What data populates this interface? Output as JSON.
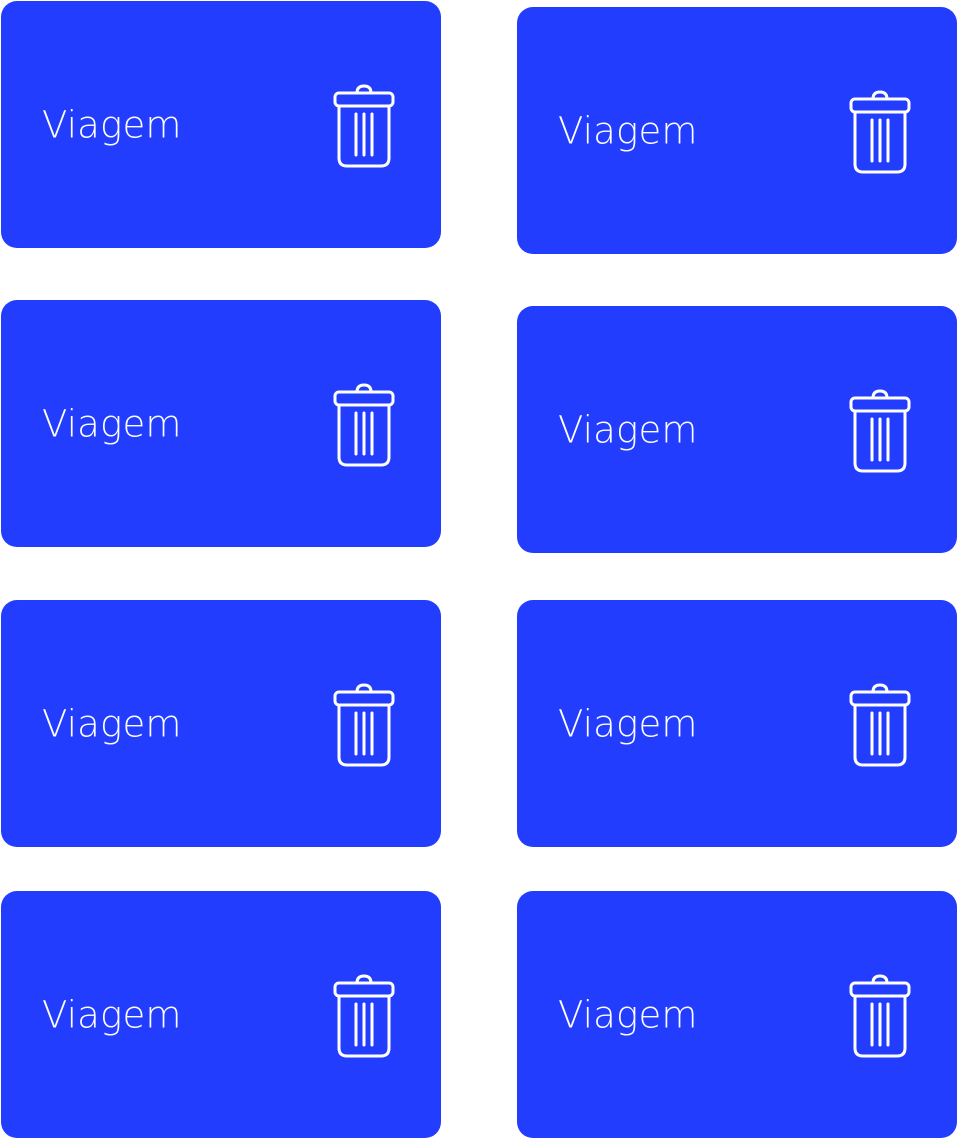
{
  "accent_color": "#233DFF",
  "text_color": "#FFFFFF",
  "cards": [
    {
      "label": "Viagem",
      "icon": "trash-icon"
    },
    {
      "label": "Viagem",
      "icon": "trash-icon"
    },
    {
      "label": "Viagem",
      "icon": "trash-icon"
    },
    {
      "label": "Viagem",
      "icon": "trash-icon"
    },
    {
      "label": "Viagem",
      "icon": "trash-icon"
    },
    {
      "label": "Viagem",
      "icon": "trash-icon"
    },
    {
      "label": "Viagem",
      "icon": "trash-icon"
    },
    {
      "label": "Viagem",
      "icon": "trash-icon"
    }
  ]
}
